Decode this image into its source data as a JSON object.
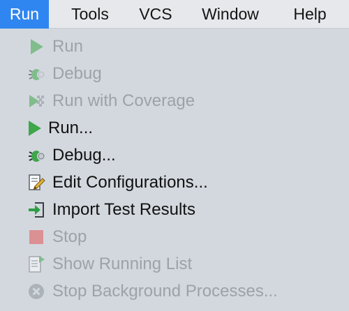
{
  "menubar": {
    "items": [
      {
        "label": "Run",
        "active": true
      },
      {
        "label": "Tools"
      },
      {
        "label": "VCS"
      },
      {
        "label": "Window"
      },
      {
        "label": "Help"
      }
    ]
  },
  "run_menu": {
    "items": [
      {
        "label": "Run",
        "icon": "run-icon",
        "enabled": false
      },
      {
        "label": "Debug",
        "icon": "debug-bug-icon",
        "enabled": false
      },
      {
        "label": "Run with Coverage",
        "icon": "coverage-icon",
        "enabled": false
      },
      {
        "label": "Run...",
        "icon": "run-icon",
        "enabled": true
      },
      {
        "label": "Debug...",
        "icon": "debug-bug-icon",
        "enabled": true
      },
      {
        "label": "Edit Configurations...",
        "icon": "edit-configurations-icon",
        "enabled": true
      },
      {
        "label": "Import Test Results",
        "icon": "import-icon",
        "enabled": true
      },
      {
        "label": "Stop",
        "icon": "stop-icon",
        "enabled": false
      },
      {
        "label": "Show Running List",
        "icon": "running-list-icon",
        "enabled": false
      },
      {
        "label": "Stop Background Processes...",
        "icon": "stop-background-icon",
        "enabled": false
      }
    ]
  },
  "colors": {
    "accent": "#2f86f0",
    "menu_background": "#d3d8de",
    "menubar_background": "#e6e8eb",
    "disabled_text": "#9ca2a9",
    "enabled_text": "#111111",
    "run_green": "#3fa64b",
    "stop_red": "#e25656"
  }
}
